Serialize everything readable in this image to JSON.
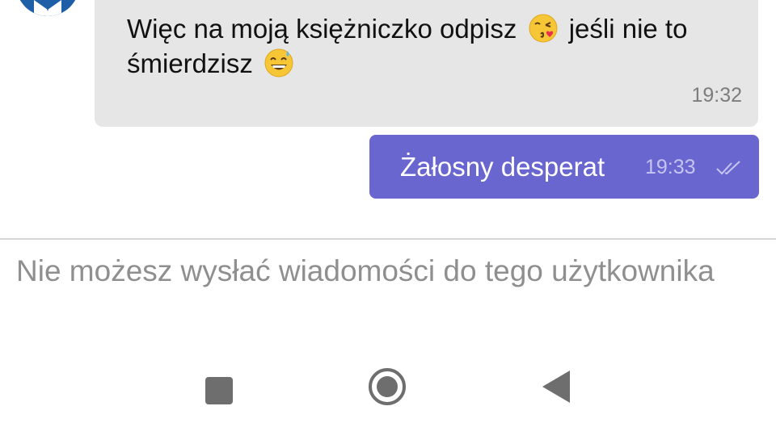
{
  "conversation": {
    "incoming_message": {
      "text_part1": "Więc na moją księżniczko odpisz",
      "emoji1": "kissing-face-icon",
      "text_part2": "jeśli nie to",
      "text_part3": "śmierdzisz",
      "emoji2": "grinning-sweat-face-icon",
      "time": "19:32"
    },
    "outgoing_message": {
      "text": "Żałosny desperat",
      "time": "19:33",
      "status_icon": "double-check-icon"
    }
  },
  "composer": {
    "blocked_notice": "Nie możesz wysłać wiadomości do tego użytkownika"
  },
  "navbar": {
    "recent_icon": "square-icon",
    "home_icon": "circle-icon",
    "back_icon": "triangle-back-icon"
  },
  "colors": {
    "outgoing_bubble": "#6a66cf",
    "incoming_bubble": "#e6e6e6",
    "avatar": "#1e5fa8"
  }
}
